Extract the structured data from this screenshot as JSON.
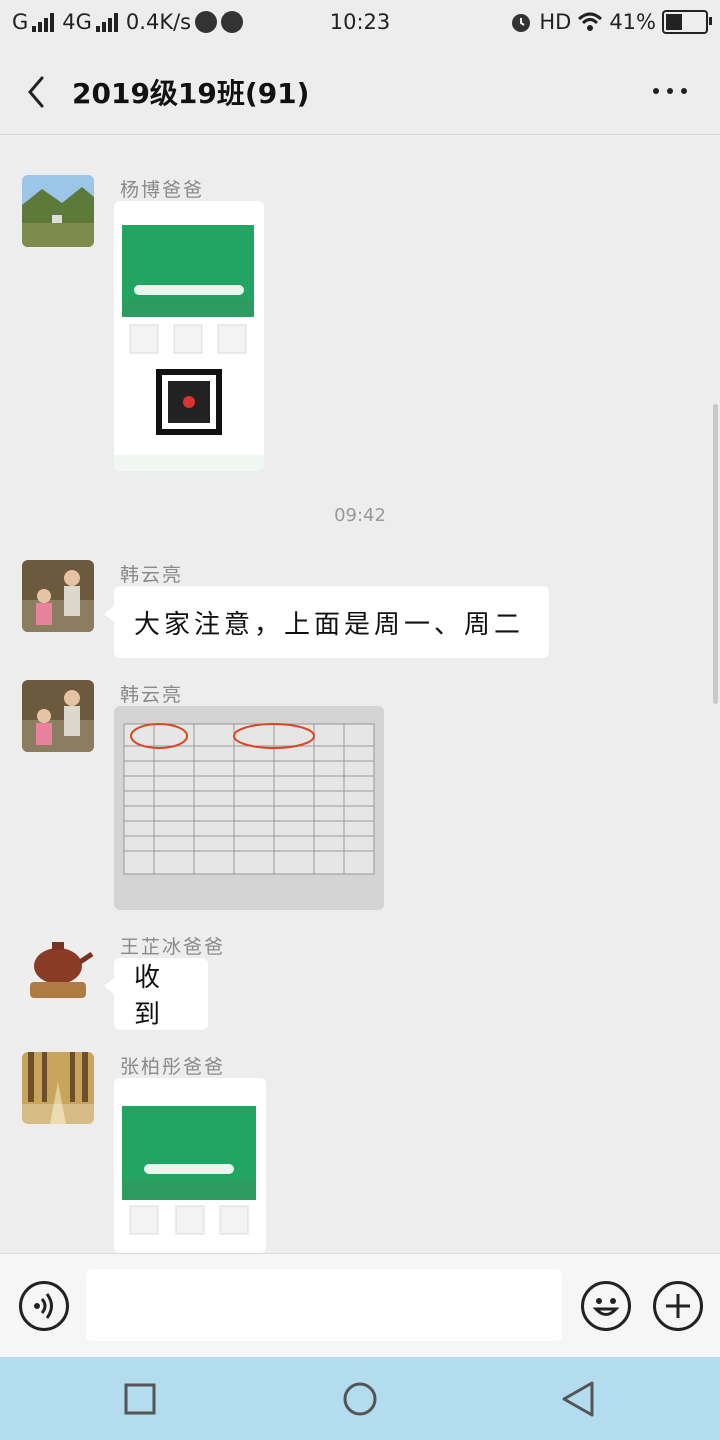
{
  "status_bar": {
    "carrier1": "G",
    "carrier2": "4G",
    "speed": "0.4K/s",
    "time": "10:23",
    "hd": "HD",
    "battery": "41%"
  },
  "header": {
    "title": "2019级19班(91)"
  },
  "messages": {
    "time_0942": "09:42",
    "m1_sender": "杨博爸爸",
    "m2_sender": "韩云亮",
    "m2_text": "大家注意，上面是周一、周二",
    "m3_sender": "韩云亮",
    "m4_sender": "王芷冰爸爸",
    "m4_text": "收到",
    "m5_sender": "张柏彤爸爸"
  },
  "colors": {
    "accent_green": "#22a463",
    "bubble_bg": "#ffffff",
    "nav_bg": "#b3dcef"
  },
  "icons": [
    "back-icon",
    "more-icon",
    "voice-icon",
    "emoji-icon",
    "plus-icon",
    "nav-back-icon",
    "nav-home-icon",
    "nav-recent-icon"
  ]
}
